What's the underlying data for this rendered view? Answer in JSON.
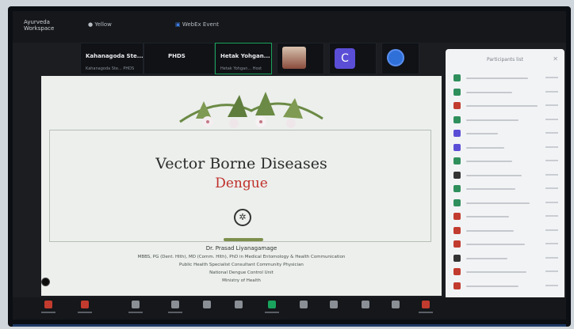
{
  "topbar": {
    "title_line1": "Ayurveda",
    "title_line2": "Workspace",
    "item_label": "Yellow",
    "tab_label": "WebEx Event"
  },
  "participants": [
    {
      "name": "Kahanagoda Ste...",
      "sub": "Kahanagoda Ste... PHDS",
      "time": "PHDS"
    },
    {
      "name": "Hetak Yohgan...",
      "sub": "Hetak Yohgan... Host"
    }
  ],
  "slide": {
    "title": "Vector Borne Diseases",
    "subtitle": "Dengue",
    "presenter": "Dr. Prasad Liyanagamage",
    "line1": "MBBS, PG (Dent. Hlth), MD (Comm. Hlth), PhD in Medical Entomology & Health Communication",
    "line2": "Public Health Specialist Consultant Community Physician",
    "line3": "National Dengue Control Unit",
    "line4": "Ministry of Health"
  },
  "panel": {
    "heading": "Participants list",
    "icons": [
      "#2f8f5c",
      "#2f8f5c",
      "#c23b2f",
      "#2f8f5c",
      "#5b4ed6",
      "#5b4ed6",
      "#2f8f5c",
      "#333333",
      "#2f8f5c",
      "#2f8f5c",
      "#c23b2f",
      "#c23b2f",
      "#c23b2f",
      "#333333",
      "#c23b2f",
      "#c23b2f"
    ]
  },
  "colors": {
    "accent_green": "#19a35c",
    "title_red": "#c0302c",
    "taskbar_blue": "#1c3a66"
  }
}
